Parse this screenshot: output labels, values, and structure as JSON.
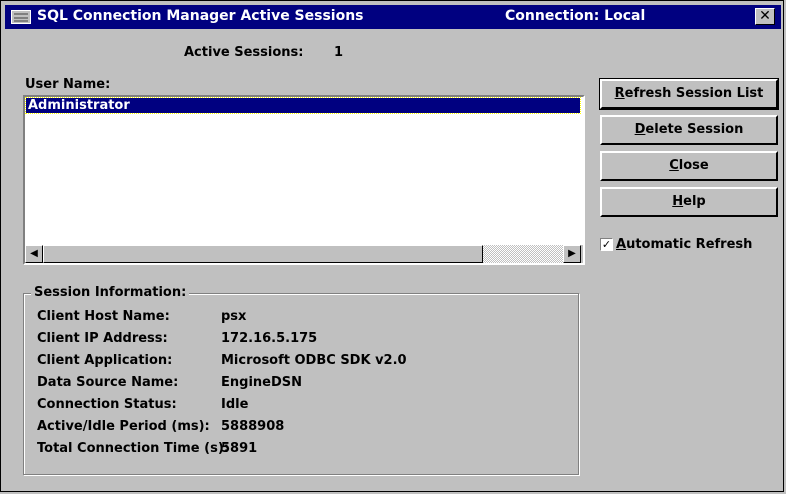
{
  "window": {
    "title": "SQL Connection Manager Active Sessions",
    "connection": "Connection: Local",
    "close_glyph": "✕"
  },
  "sessions": {
    "active_label": "Active Sessions:",
    "active_count": "1",
    "user_label": "User Name:",
    "users": [
      "Administrator"
    ]
  },
  "scrollbar": {
    "left_arrow": "◀",
    "right_arrow": "▶"
  },
  "buttons": {
    "refresh": {
      "u": "R",
      "rest": "efresh Session List"
    },
    "delete": {
      "u": "D",
      "rest": "elete Session"
    },
    "close": {
      "u": "C",
      "rest": "lose"
    },
    "help": {
      "u": "H",
      "rest": "elp"
    }
  },
  "auto_refresh": {
    "checked": true,
    "check_glyph": "✓",
    "u": "A",
    "rest": "utomatic Refresh"
  },
  "session_info": {
    "title": "Session Information:",
    "rows": [
      {
        "label": "Client Host Name:",
        "value": "psx"
      },
      {
        "label": "Client IP Address:",
        "value": "172.16.5.175"
      },
      {
        "label": "Client Application:",
        "value": "Microsoft ODBC SDK v2.0"
      },
      {
        "label": "Data Source Name:",
        "value": "EngineDSN"
      },
      {
        "label": "Connection Status:",
        "value": "Idle"
      },
      {
        "label": "Active/Idle Period (ms):",
        "value": "5888908"
      },
      {
        "label": "Total Connection Time (s):",
        "value": "5891"
      }
    ]
  },
  "colors": {
    "titlebar": "#000080",
    "face": "#c0c0c0",
    "selection": "#000080"
  },
  "icons": {
    "title": "window-app-icon",
    "close": "close-icon",
    "left": "arrow-left-icon",
    "right": "arrow-right-icon",
    "check": "checkmark-icon"
  }
}
